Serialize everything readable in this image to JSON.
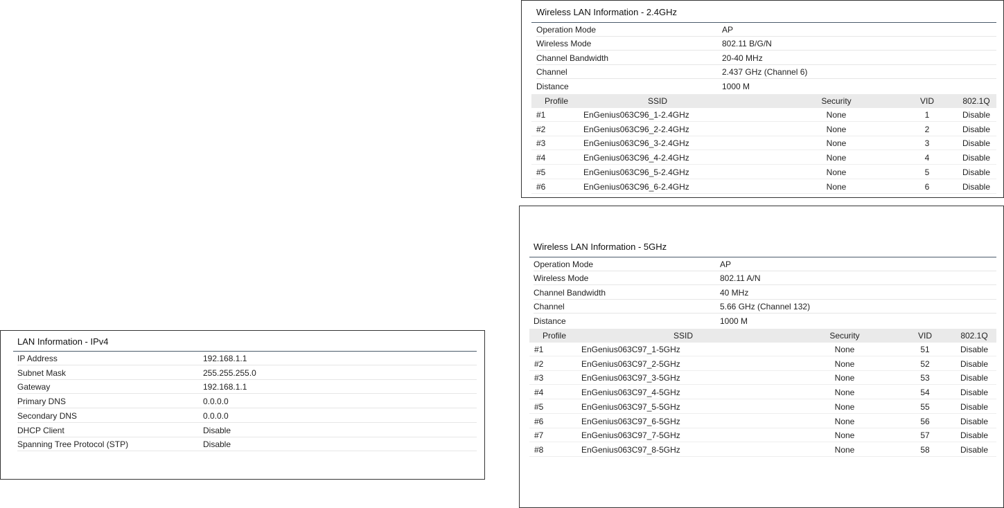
{
  "wlan24": {
    "title": "Wireless LAN Information - 2.4GHz",
    "info": [
      {
        "label": "Operation Mode",
        "value": "AP"
      },
      {
        "label": "Wireless Mode",
        "value": "802.11 B/G/N"
      },
      {
        "label": "Channel Bandwidth",
        "value": "20-40 MHz"
      },
      {
        "label": "Channel",
        "value": "2.437 GHz (Channel 6)"
      },
      {
        "label": "Distance",
        "value": "1000 M"
      }
    ],
    "headers": {
      "profile": "Profile",
      "ssid": "SSID",
      "security": "Security",
      "vid": "VID",
      "q": "802.1Q"
    },
    "profiles": [
      {
        "profile": "#1",
        "ssid": "EnGenius063C96_1-2.4GHz",
        "security": "None",
        "vid": "1",
        "q": "Disable"
      },
      {
        "profile": "#2",
        "ssid": "EnGenius063C96_2-2.4GHz",
        "security": "None",
        "vid": "2",
        "q": "Disable"
      },
      {
        "profile": "#3",
        "ssid": "EnGenius063C96_3-2.4GHz",
        "security": "None",
        "vid": "3",
        "q": "Disable"
      },
      {
        "profile": "#4",
        "ssid": "EnGenius063C96_4-2.4GHz",
        "security": "None",
        "vid": "4",
        "q": "Disable"
      },
      {
        "profile": "#5",
        "ssid": "EnGenius063C96_5-2.4GHz",
        "security": "None",
        "vid": "5",
        "q": "Disable"
      },
      {
        "profile": "#6",
        "ssid": "EnGenius063C96_6-2.4GHz",
        "security": "None",
        "vid": "6",
        "q": "Disable"
      }
    ]
  },
  "wlan5": {
    "title": "Wireless LAN Information - 5GHz",
    "info": [
      {
        "label": "Operation Mode",
        "value": "AP"
      },
      {
        "label": "Wireless Mode",
        "value": "802.11 A/N"
      },
      {
        "label": "Channel Bandwidth",
        "value": "40 MHz"
      },
      {
        "label": "Channel",
        "value": "5.66 GHz (Channel 132)"
      },
      {
        "label": "Distance",
        "value": "1000 M"
      }
    ],
    "headers": {
      "profile": "Profile",
      "ssid": "SSID",
      "security": "Security",
      "vid": "VID",
      "q": "802.1Q"
    },
    "profiles": [
      {
        "profile": "#1",
        "ssid": "EnGenius063C97_1-5GHz",
        "security": "None",
        "vid": "51",
        "q": "Disable"
      },
      {
        "profile": "#2",
        "ssid": "EnGenius063C97_2-5GHz",
        "security": "None",
        "vid": "52",
        "q": "Disable"
      },
      {
        "profile": "#3",
        "ssid": "EnGenius063C97_3-5GHz",
        "security": "None",
        "vid": "53",
        "q": "Disable"
      },
      {
        "profile": "#4",
        "ssid": "EnGenius063C97_4-5GHz",
        "security": "None",
        "vid": "54",
        "q": "Disable"
      },
      {
        "profile": "#5",
        "ssid": "EnGenius063C97_5-5GHz",
        "security": "None",
        "vid": "55",
        "q": "Disable"
      },
      {
        "profile": "#6",
        "ssid": "EnGenius063C97_6-5GHz",
        "security": "None",
        "vid": "56",
        "q": "Disable"
      },
      {
        "profile": "#7",
        "ssid": "EnGenius063C97_7-5GHz",
        "security": "None",
        "vid": "57",
        "q": "Disable"
      },
      {
        "profile": "#8",
        "ssid": "EnGenius063C97_8-5GHz",
        "security": "None",
        "vid": "58",
        "q": "Disable"
      }
    ]
  },
  "lan": {
    "title": "LAN Information - IPv4",
    "info": [
      {
        "label": "IP Address",
        "value": "192.168.1.1"
      },
      {
        "label": "Subnet Mask",
        "value": "255.255.255.0"
      },
      {
        "label": "Gateway",
        "value": "192.168.1.1"
      },
      {
        "label": "Primary DNS",
        "value": "0.0.0.0"
      },
      {
        "label": "Secondary DNS",
        "value": "0.0.0.0"
      },
      {
        "label": "DHCP Client",
        "value": "Disable"
      },
      {
        "label": "Spanning Tree Protocol (STP)",
        "value": "Disable"
      }
    ]
  }
}
